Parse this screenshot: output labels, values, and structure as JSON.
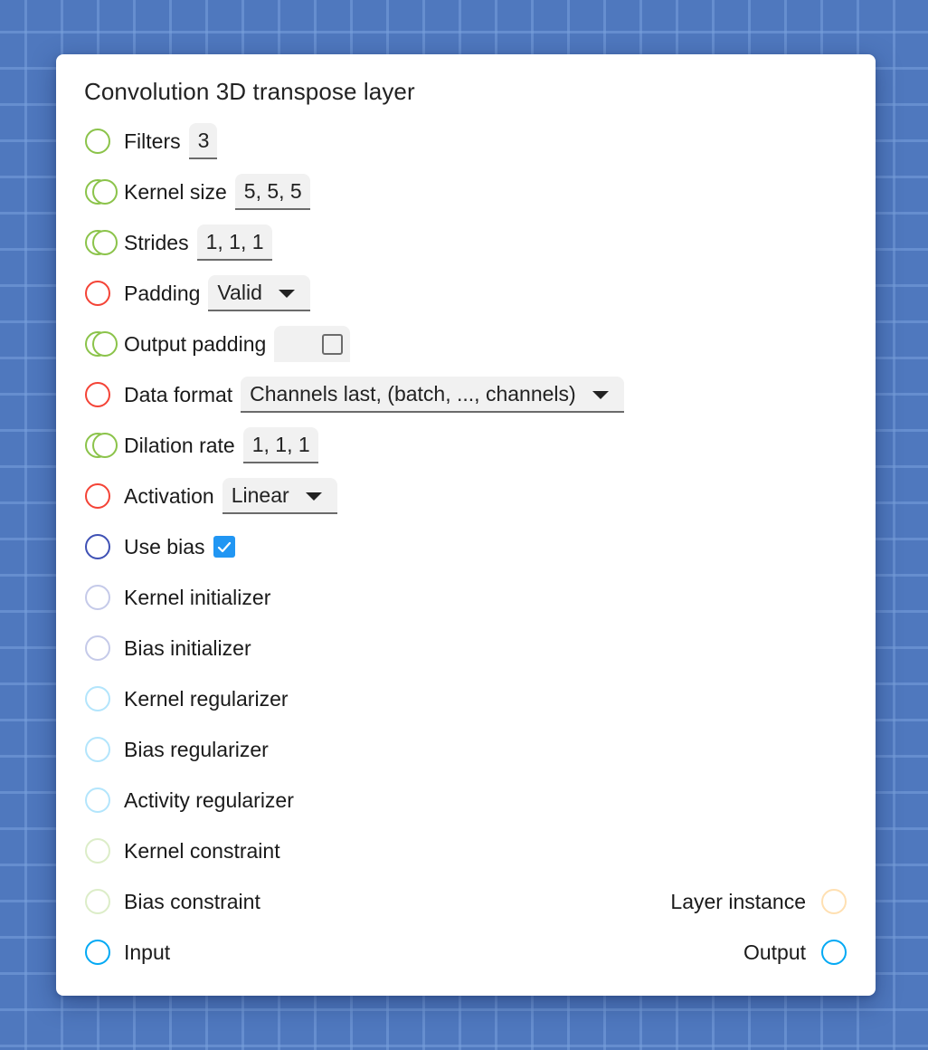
{
  "node": {
    "title": "Convolution 3D transpose layer",
    "params": [
      {
        "id": "filters",
        "label": "Filters",
        "port": "single",
        "port_color": "#8bc34a",
        "control": "text",
        "value": "3"
      },
      {
        "id": "kernel-size",
        "label": "Kernel size",
        "port": "double",
        "port_color": "#8bc34a",
        "control": "text",
        "value": "5, 5, 5"
      },
      {
        "id": "strides",
        "label": "Strides",
        "port": "double",
        "port_color": "#8bc34a",
        "control": "text",
        "value": "1, 1, 1"
      },
      {
        "id": "padding",
        "label": "Padding",
        "port": "single",
        "port_color": "#f44336",
        "control": "select",
        "value": "Valid"
      },
      {
        "id": "output-padding",
        "label": "Output padding",
        "port": "double",
        "port_color": "#8bc34a",
        "control": "checkbox",
        "checked": false
      },
      {
        "id": "data-format",
        "label": "Data format",
        "port": "single",
        "port_color": "#f44336",
        "control": "select",
        "value": "Channels last, (batch, ..., channels)"
      },
      {
        "id": "dilation-rate",
        "label": "Dilation rate",
        "port": "double",
        "port_color": "#8bc34a",
        "control": "text",
        "value": "1, 1, 1"
      },
      {
        "id": "activation",
        "label": "Activation",
        "port": "single",
        "port_color": "#f44336",
        "control": "select",
        "value": "Linear"
      },
      {
        "id": "use-bias",
        "label": "Use bias",
        "port": "single",
        "port_color": "#3f51b5",
        "control": "checkbox",
        "checked": true
      },
      {
        "id": "kernel-initializer",
        "label": "Kernel initializer",
        "port": "single",
        "port_color": "#c5cae9"
      },
      {
        "id": "bias-initializer",
        "label": "Bias initializer",
        "port": "single",
        "port_color": "#c5cae9"
      },
      {
        "id": "kernel-regularizer",
        "label": "Kernel regularizer",
        "port": "single",
        "port_color": "#b3e5fc"
      },
      {
        "id": "bias-regularizer",
        "label": "Bias regularizer",
        "port": "single",
        "port_color": "#b3e5fc"
      },
      {
        "id": "activity-regularizer",
        "label": "Activity regularizer",
        "port": "single",
        "port_color": "#b3e5fc"
      },
      {
        "id": "kernel-constraint",
        "label": "Kernel constraint",
        "port": "single",
        "port_color": "#dcedc8"
      },
      {
        "id": "bias-constraint",
        "label": "Bias constraint",
        "port": "single",
        "port_color": "#dcedc8"
      },
      {
        "id": "input",
        "label": "Input",
        "port": "single",
        "port_color": "#03a9f4"
      }
    ],
    "outputs": [
      {
        "id": "layer-instance",
        "label": "Layer instance",
        "port_color": "#ffe0b2"
      },
      {
        "id": "output",
        "label": "Output",
        "port_color": "#03a9f4"
      }
    ]
  }
}
